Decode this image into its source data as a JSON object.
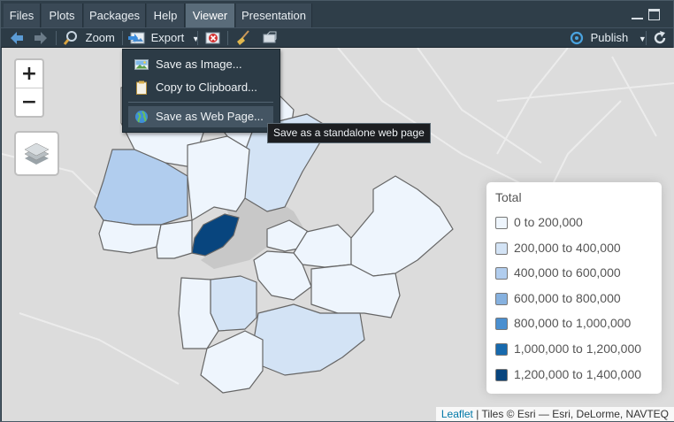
{
  "tabs": [
    {
      "label": "Files",
      "active": false
    },
    {
      "label": "Plots",
      "active": false
    },
    {
      "label": "Packages",
      "active": false
    },
    {
      "label": "Help",
      "active": false
    },
    {
      "label": "Viewer",
      "active": true
    },
    {
      "label": "Presentation",
      "active": false
    }
  ],
  "toolbar": {
    "zoom_label": "Zoom",
    "export_label": "Export",
    "publish_label": "Publish"
  },
  "export_menu": {
    "items": [
      {
        "label": "Save as Image...",
        "icon": "image-icon"
      },
      {
        "label": "Copy to Clipboard...",
        "icon": "clipboard-icon"
      },
      {
        "label": "Save as Web Page...",
        "icon": "globe-icon",
        "highlighted": true
      }
    ],
    "tooltip": "Save as a standalone web page"
  },
  "map": {
    "zoom_in_label": "+",
    "zoom_out_label": "−",
    "legend": {
      "title": "Total",
      "entries": [
        {
          "label": "0 to 200,000",
          "color": "#eef5fd"
        },
        {
          "label": "200,000 to 400,000",
          "color": "#d3e3f5"
        },
        {
          "label": "400,000 to 600,000",
          "color": "#b1cdee"
        },
        {
          "label": "600,000 to 800,000",
          "color": "#86b1df"
        },
        {
          "label": "800,000 to 1,000,000",
          "color": "#4a8fd0"
        },
        {
          "label": "1,000,000 to 1,200,000",
          "color": "#1769ad"
        },
        {
          "label": "1,200,000 to 1,400,000",
          "color": "#08457e"
        }
      ]
    },
    "attribution": {
      "link": "Leaflet",
      "text": " | Tiles © Esri — Esri, DeLorme, NAVTEQ"
    }
  }
}
